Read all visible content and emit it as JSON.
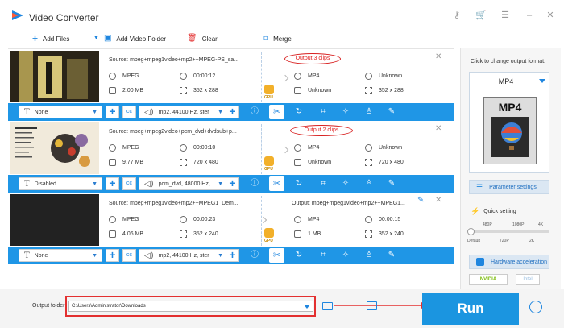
{
  "app": {
    "title": "Video Converter",
    "window_controls": {
      "key_icon": "key-icon",
      "cart_icon": "cart-icon",
      "menu_icon": "menu-icon",
      "minimize": "–",
      "close": "✕"
    }
  },
  "toolbar": {
    "add_files": "Add Files",
    "add_video_folder": "Add Video Folder",
    "clear": "Clear",
    "merge": "Merge"
  },
  "items": [
    {
      "source": "Source: mpeg+mpeg1video+mp2++MPEG-PS_sa...",
      "output_note": "Output 3 clips",
      "src_format": "MPEG",
      "src_duration": "00:00:12",
      "src_size": "2.00 MB",
      "src_resolution": "352 x 288",
      "out_format": "MP4",
      "out_duration": "Unknown",
      "out_size": "Unknown",
      "out_resolution": "352 x 288",
      "subtitle": "None",
      "audio": "mp2, 44100 Hz, ster"
    },
    {
      "source": "Source: mpeg+mpeg2video+pcm_dvd+dvdsub+p...",
      "output_note": "Output 2 clips",
      "src_format": "MPEG",
      "src_duration": "00:00:10",
      "src_size": "9.77 MB",
      "src_resolution": "720 x 480",
      "out_format": "MP4",
      "out_duration": "Unknown",
      "out_size": "Unknown",
      "out_resolution": "720 x 480",
      "subtitle": "Disabled",
      "audio": "pcm_dvd, 48000 Hz,"
    },
    {
      "source": "Source: mpeg+mpeg1video+mp2++MPEG1_Dem...",
      "output_name": "Output: mpeg+mpeg1video+mp2++MPEG1...",
      "src_format": "MPEG",
      "src_duration": "00:00:23",
      "src_size": "4.06 MB",
      "src_resolution": "352 x 240",
      "out_format": "MP4",
      "out_duration": "00:00:15",
      "out_size": "1 MB",
      "out_resolution": "352 x 240",
      "subtitle": "None",
      "audio": "mp2, 44100 Hz, ster"
    }
  ],
  "gpu_label": "GPU",
  "right_panel": {
    "title": "Click to change output format:",
    "format": "MP4",
    "format_file_label": "MP4",
    "parameter_settings": "Parameter settings",
    "quick_setting": "Quick setting",
    "quality_top": [
      "480P",
      "1080P",
      "4K"
    ],
    "quality_bottom": [
      "Default",
      "720P",
      "2K"
    ],
    "quality_level": 0.0,
    "hardware_acceleration": "Hardware acceleration",
    "nvidia": "NVIDIA",
    "intel": "Intel"
  },
  "bottom": {
    "output_folder_label": "Output folder:",
    "output_folder_value": "C:\\Users\\Administrator\\Downloads",
    "run": "Run"
  },
  "colors": {
    "accent": "#1f96e6",
    "highlight_red": "#e33030",
    "gpu_orange": "#f2b02a"
  }
}
